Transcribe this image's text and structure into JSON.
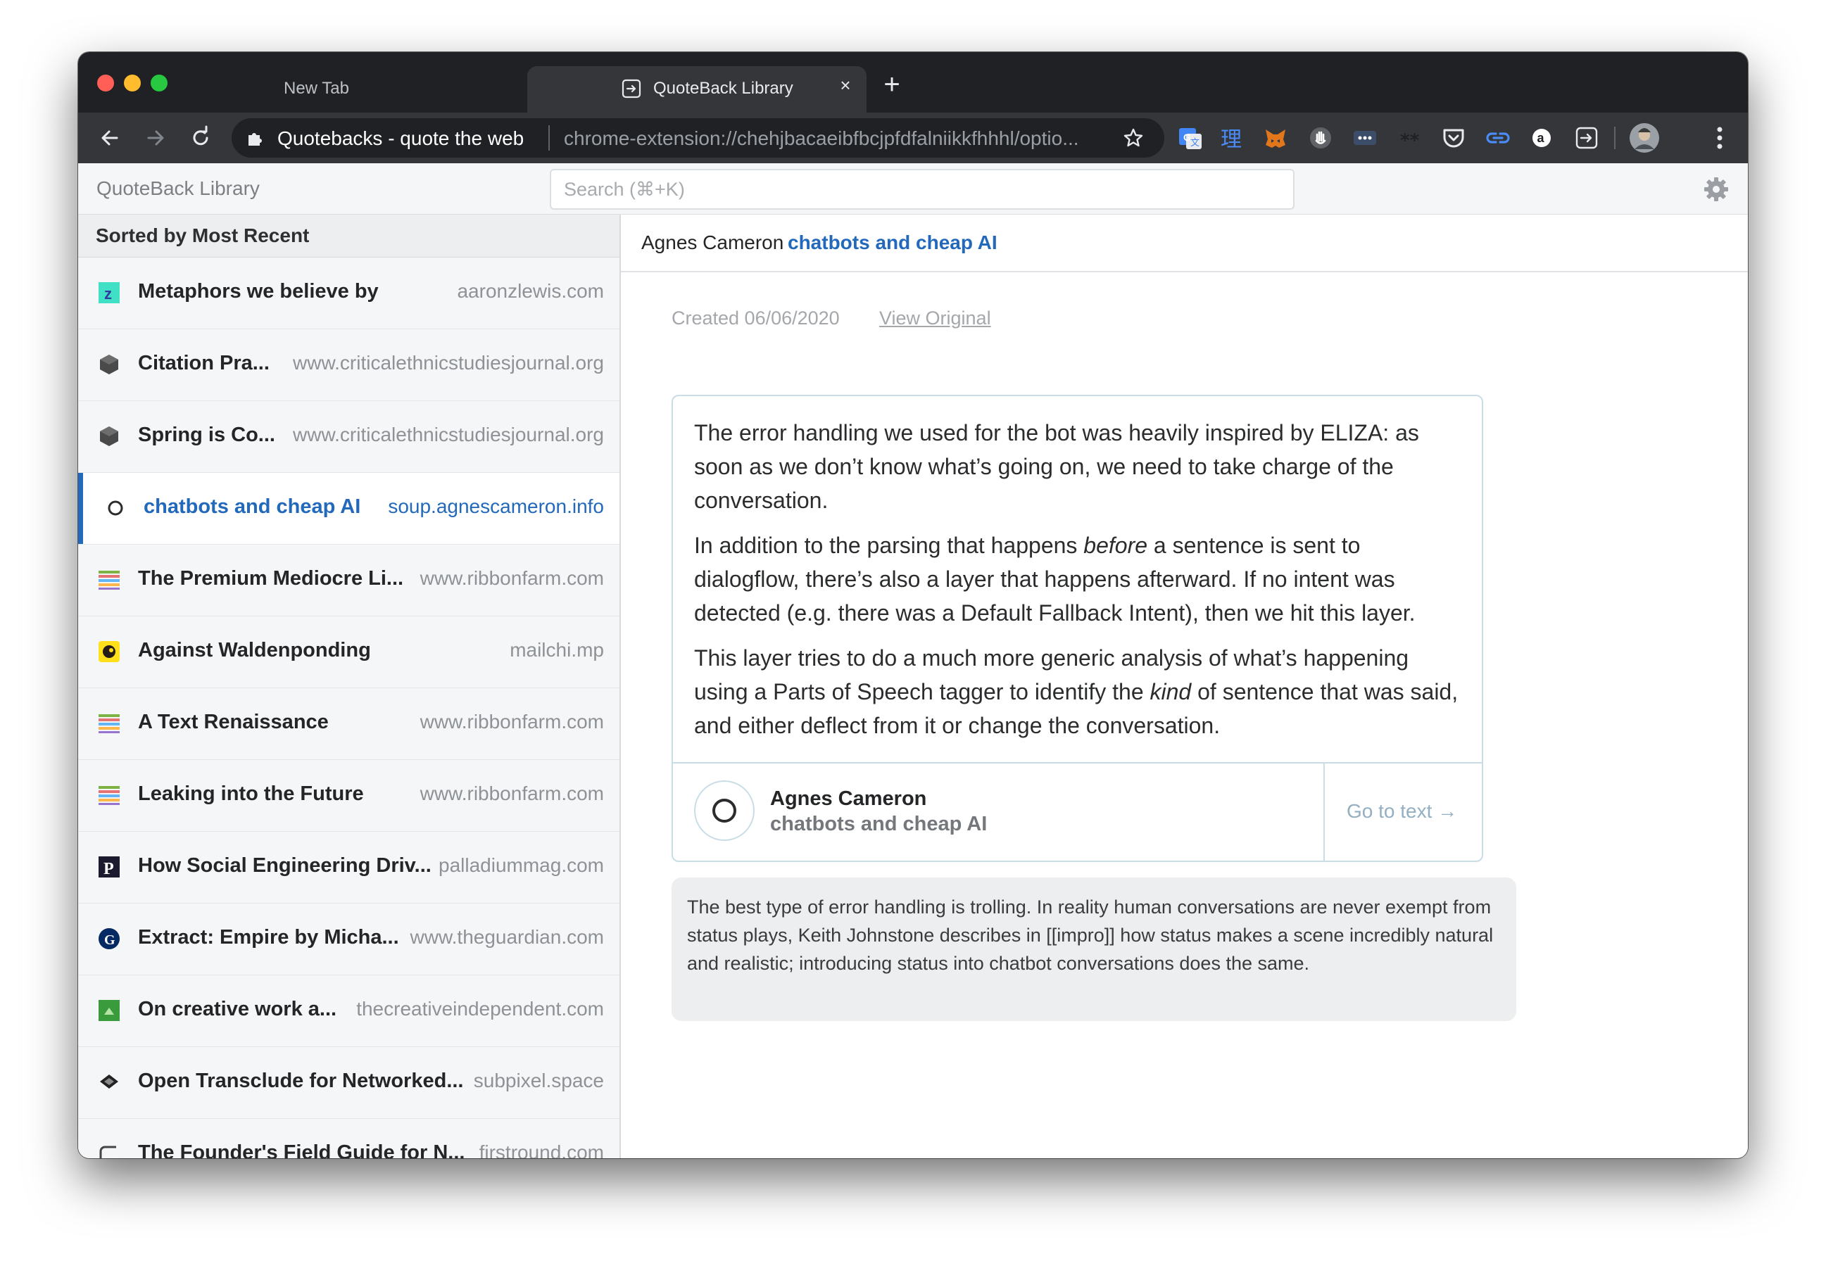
{
  "browser": {
    "tabs": [
      {
        "title": "New Tab",
        "active": false
      },
      {
        "title": "QuoteBack Library",
        "active": true
      }
    ],
    "site_name": "Quotebacks - quote the web",
    "url": "chrome-extension://chehjbacaeibfbcjpfdfalniikkfhhhl/optio...",
    "extension_icons": [
      "google-translate-icon",
      "kanji-extension-icon",
      "metamask-fox-icon",
      "hand-extension-icon",
      "dots-extension-icon",
      "double-asterisk-icon",
      "pocket-icon",
      "link-extension-icon",
      "amazon-assistant-icon",
      "quoteback-extension-icon",
      "profile-avatar-icon"
    ]
  },
  "app": {
    "title": "QuoteBack Library",
    "search_placeholder": "Search (⌘+K)"
  },
  "sidebar": {
    "sort_label": "Sorted by Most Recent",
    "items": [
      {
        "title": "Metaphors we believe by",
        "domain": "aaronzlewis.com",
        "icon": "z-favicon",
        "selected": false
      },
      {
        "title": "Citation Pra...",
        "domain": "www.criticalethnicstudiesjournal.org",
        "icon": "cube-favicon",
        "selected": false
      },
      {
        "title": "Spring is Co...",
        "domain": "www.criticalethnicstudiesjournal.org",
        "icon": "cube-favicon",
        "selected": false
      },
      {
        "title": "chatbots and cheap AI",
        "domain": "soup.agnescameron.info",
        "icon": "circle-favicon",
        "selected": true
      },
      {
        "title": "The Premium Mediocre Li...",
        "domain": "www.ribbonfarm.com",
        "icon": "ribbonfarm-favicon",
        "selected": false
      },
      {
        "title": "Against Waldenponding",
        "domain": "mailchi.mp",
        "icon": "mailchimp-favicon",
        "selected": false
      },
      {
        "title": "A Text Renaissance",
        "domain": "www.ribbonfarm.com",
        "icon": "ribbonfarm-favicon",
        "selected": false
      },
      {
        "title": "Leaking into the Future",
        "domain": "www.ribbonfarm.com",
        "icon": "ribbonfarm-favicon",
        "selected": false
      },
      {
        "title": "How Social Engineering Driv...",
        "domain": "palladiummag.com",
        "icon": "palladium-favicon",
        "selected": false
      },
      {
        "title": "Extract: Empire by Micha...",
        "domain": "www.theguardian.com",
        "icon": "guardian-favicon",
        "selected": false
      },
      {
        "title": "On creative work a...",
        "domain": "thecreativeindependent.com",
        "icon": "creative-independent-favicon",
        "selected": false
      },
      {
        "title": "Open Transclude for Networked...",
        "domain": "subpixel.space",
        "icon": "diamond-favicon",
        "selected": false
      },
      {
        "title": "The Founder's Field Guide for N...",
        "domain": "firstround.com",
        "icon": "firstround-favicon",
        "selected": false
      }
    ]
  },
  "detail": {
    "author": "Agnes Cameron",
    "title": "chatbots and cheap AI",
    "created": "Created 06/06/2020",
    "view_original": "View Original",
    "quote": {
      "p1": "The error handling we used for the bot was heavily inspired by ELIZA: as soon as we don’t know what’s going on, we need to take charge of the conversation.",
      "p2_a": "In addition to the parsing that happens ",
      "p2_em": "before",
      "p2_b": " a sentence is sent to dialogflow, there’s also a layer that happens afterward. If no intent was detected (e.g. there was a Default Fallback Intent), then we hit this layer.",
      "p3_a": "This layer tries to do a much more generic analysis of what’s happening using a Parts of Speech tagger to identify the ",
      "p3_em": "kind",
      "p3_b": " of sentence that was said, and either deflect from it or change the conversation."
    },
    "footer_author": "Agnes Cameron",
    "footer_title": "chatbots and cheap AI",
    "go_to_text": "Go to text →",
    "comment": "The best type of error handling is trolling. In reality human conversations are never exempt from status plays, Keith Johnstone describes in [[impro]] how status makes a scene incredibly natural and realistic; introducing status into chatbot conversations does the same."
  },
  "colors": {
    "accent": "#2269bb",
    "card_border": "#c9dde6",
    "sidebar_bg": "#f5f6f7",
    "comment_bg": "#eceef0",
    "chrome_dark": "#202124",
    "chrome_toolbar": "#35363a"
  }
}
